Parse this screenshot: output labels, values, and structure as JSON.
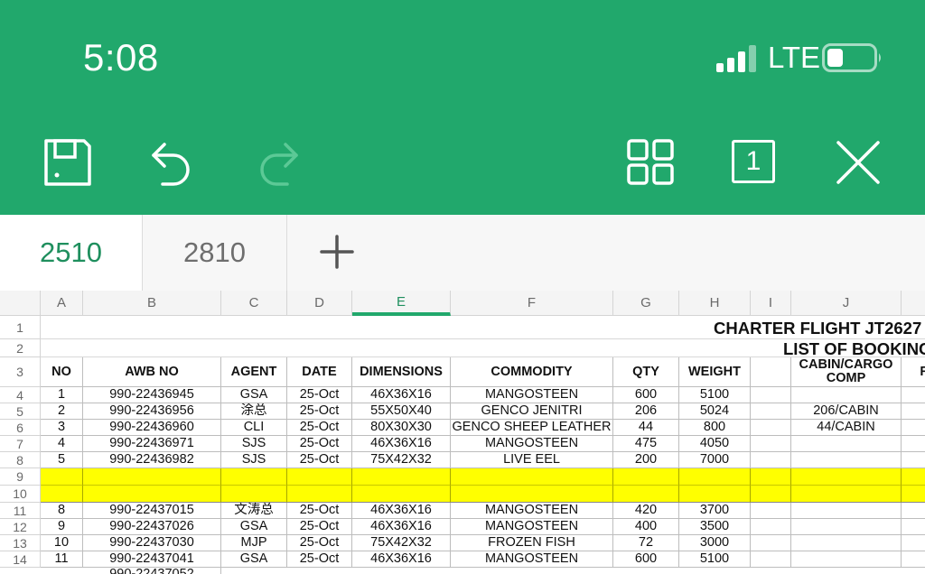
{
  "status_bar": {
    "time": "5:08",
    "network": "LTE"
  },
  "toolbar": {
    "icons": [
      "save-icon",
      "undo-icon",
      "redo-icon",
      "grid-view-icon",
      "sheet-count-icon",
      "close-icon"
    ],
    "sheet_count": "1"
  },
  "tabs": [
    {
      "label": "2510",
      "active": true
    },
    {
      "label": "2810",
      "active": false
    }
  ],
  "sheet": {
    "columns": [
      "A",
      "B",
      "C",
      "D",
      "E",
      "F",
      "G",
      "H",
      "I",
      "J"
    ],
    "selected_column": "E",
    "row_numbers": [
      "1",
      "2",
      "3",
      "4",
      "5",
      "6",
      "7",
      "8",
      "9",
      "10",
      "11",
      "12",
      "13",
      "14"
    ],
    "title_line1": "CHARTER FLIGHT JT2627",
    "title_line2": "LIST OF BOOKING",
    "headers": [
      "NO",
      "AWB NO",
      "AGENT",
      "DATE",
      "DIMENSIONS",
      "COMMODITY",
      "QTY",
      "WEIGHT",
      "",
      "CABIN/CARGO COMP",
      "RE"
    ],
    "rows": [
      {
        "row": "4",
        "cells": [
          "1",
          "990-22436945",
          "GSA",
          "25-Oct",
          "46X36X16",
          "MANGOSTEEN",
          "600",
          "5100",
          "",
          ""
        ]
      },
      {
        "row": "5",
        "cells": [
          "2",
          "990-22436956",
          "涂总",
          "25-Oct",
          "55X50X40",
          "GENCO JENITRI",
          "206",
          "5024",
          "",
          "206/CABIN"
        ]
      },
      {
        "row": "6",
        "cells": [
          "3",
          "990-22436960",
          "CLI",
          "25-Oct",
          "80X30X30",
          "GENCO SHEEP LEATHER",
          "44",
          "800",
          "",
          "44/CABIN"
        ]
      },
      {
        "row": "7",
        "cells": [
          "4",
          "990-22436971",
          "SJS",
          "25-Oct",
          "46X36X16",
          "MANGOSTEEN",
          "475",
          "4050",
          "",
          ""
        ]
      },
      {
        "row": "8",
        "cells": [
          "5",
          "990-22436982",
          "SJS",
          "25-Oct",
          "75X42X32",
          "LIVE EEL",
          "200",
          "7000",
          "",
          ""
        ]
      },
      {
        "row": "11",
        "cells": [
          "8",
          "990-22437015",
          "文涛总",
          "25-Oct",
          "46X36X16",
          "MANGOSTEEN",
          "420",
          "3700",
          "",
          ""
        ]
      },
      {
        "row": "12",
        "cells": [
          "9",
          "990-22437026",
          "GSA",
          "25-Oct",
          "46X36X16",
          "MANGOSTEEN",
          "400",
          "3500",
          "",
          ""
        ]
      },
      {
        "row": "13",
        "cells": [
          "10",
          "990-22437030",
          "MJP",
          "25-Oct",
          "75X42X32",
          "FROZEN FISH",
          "72",
          "3000",
          "",
          ""
        ]
      },
      {
        "row": "14",
        "cells": [
          "11",
          "990-22437041",
          "GSA",
          "25-Oct",
          "46X36X16",
          "MANGOSTEEN",
          "600",
          "5100",
          "",
          ""
        ]
      }
    ],
    "highlight_color": "#ffff00"
  },
  "colors": {
    "brand": "#21a86c",
    "active_tab_text": "#1f8f5e"
  }
}
